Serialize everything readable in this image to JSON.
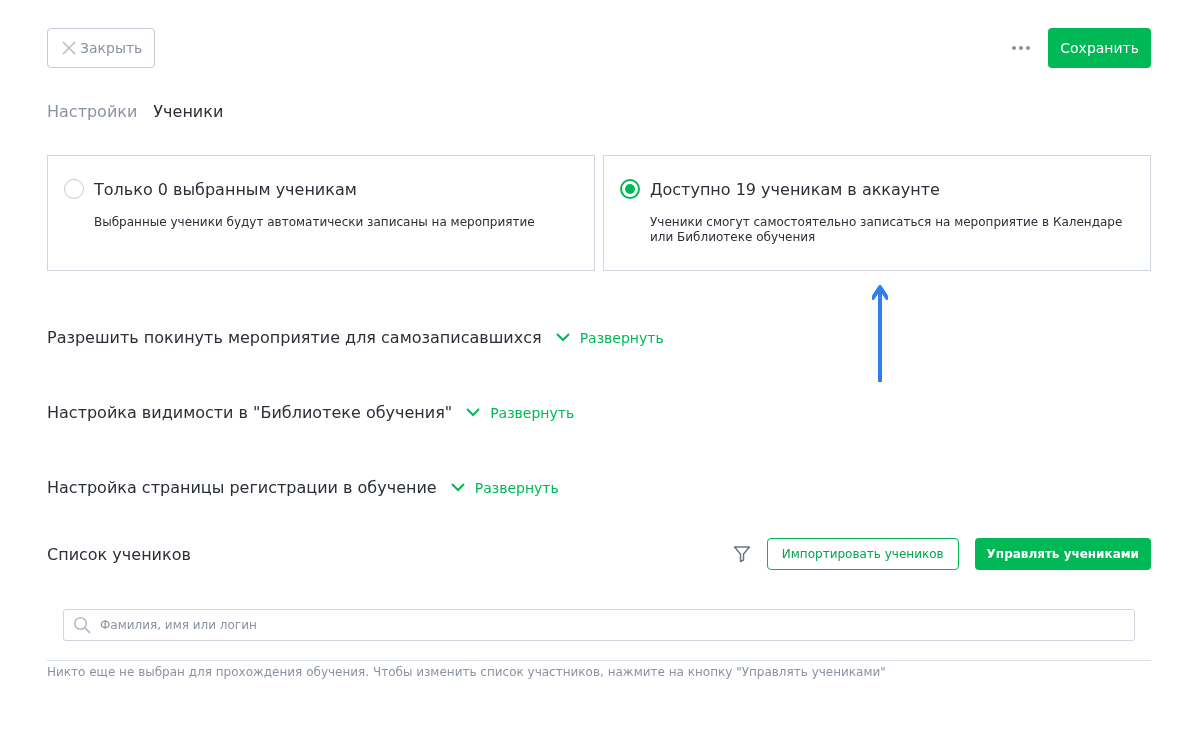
{
  "toolbar": {
    "close_button": "Закрыть",
    "save_button": "Сохранить"
  },
  "tabs": [
    {
      "label": "Настройки",
      "selected": false
    },
    {
      "label": "Ученики",
      "selected": true
    }
  ],
  "access_options": [
    {
      "title": "Только 0 выбранным ученикам",
      "description": "Выбранные ученики будут автоматически записаны на мероприятие",
      "selected": false
    },
    {
      "title": "Доступно 19 ученикам в аккаунте",
      "description": "Ученики смогут самостоятельно записаться на мероприятие в Календаре или Библиотеке обучения",
      "selected": true
    }
  ],
  "sections": [
    {
      "title": "Разрешить покинуть мероприятие для самозаписавшихся",
      "toggle": "Развернуть",
      "expanded": false
    },
    {
      "title": "Настройка видимости в \"Библиотеке обучения\"",
      "toggle": "Развернуть",
      "expanded": false
    },
    {
      "title": "Настройка страницы регистрации в обучение",
      "toggle": "Развернуть",
      "expanded": false
    }
  ],
  "student_list": {
    "title": "Список учеников",
    "import_button": "Импортировать учеников",
    "manage_button": "Управлять учениками",
    "search": {
      "placeholder": "Фамилия, имя или логин"
    },
    "empty_note": "Никто еще не выбран для прохождения обучения. Чтобы изменить список участников, нажмите на кнопку \"Управлять учениками\""
  }
}
